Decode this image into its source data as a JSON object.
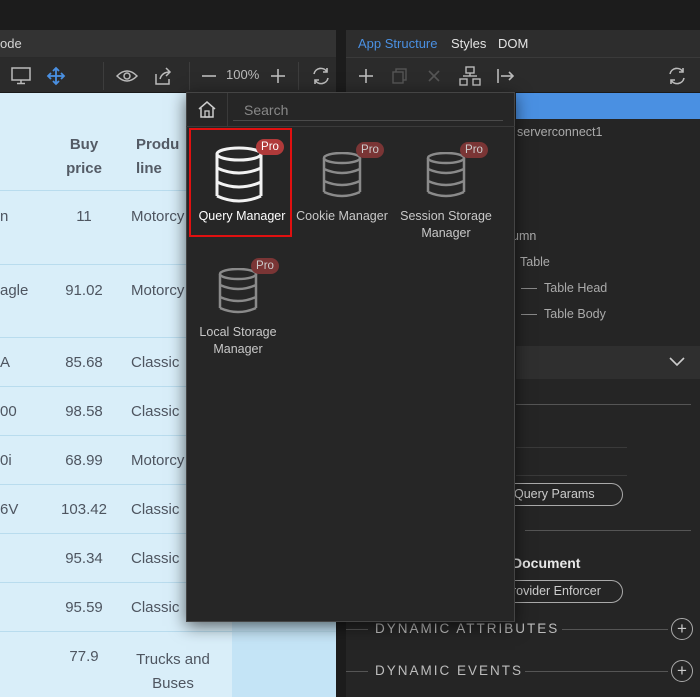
{
  "left": {
    "tab_label": "ode",
    "zoom": "100%",
    "table": {
      "headers": {
        "buy_price": "Buy price",
        "product_line": "Produ line"
      },
      "rows": [
        {
          "name": "n",
          "price": "11",
          "line": "Motorcy"
        },
        {
          "name": "agle",
          "price": "91.02",
          "line": "Motorcy"
        },
        {
          "name": "A",
          "price": "85.68",
          "line": "Classic"
        },
        {
          "name": "00",
          "price": "98.58",
          "line": "Classic"
        },
        {
          "name": "0i",
          "price": "68.99",
          "line": "Motorcy"
        },
        {
          "name": "6V",
          "price": "103.42",
          "line": "Classic"
        },
        {
          "name": "",
          "price": "95.34",
          "line": "Classic"
        },
        {
          "name": "",
          "price": "95.59",
          "line": "Classic"
        },
        {
          "name": "",
          "price": "77.9",
          "line": "Trucks and Buses"
        }
      ]
    }
  },
  "right": {
    "tabs": [
      "App Structure",
      "Styles",
      "DOM"
    ],
    "tree": {
      "serverconnect": "serverconnect1",
      "column": "umn",
      "table": "Table",
      "table_head": "Table Head",
      "table_body": "Table Body"
    },
    "query_params": "Query Params",
    "document": "Document",
    "provider_enforcer": "rovider Enforcer",
    "dynamic_attributes": "DYNAMIC ATTRIBUTES",
    "dynamic_events": "DYNAMIC EVENTS",
    "plus": "+"
  },
  "popup": {
    "search_placeholder": "Search",
    "badge": "Pro",
    "components": [
      {
        "label": "Query Manager"
      },
      {
        "label": "Cookie Manager"
      },
      {
        "label": "Session Storage Manager"
      },
      {
        "label": "Local Storage Manager"
      }
    ]
  },
  "colors": {
    "accent": "#4a90e2",
    "pro_badge": "#b03a3a",
    "selection": "#e01010",
    "table_bg": "#d9eef9"
  }
}
